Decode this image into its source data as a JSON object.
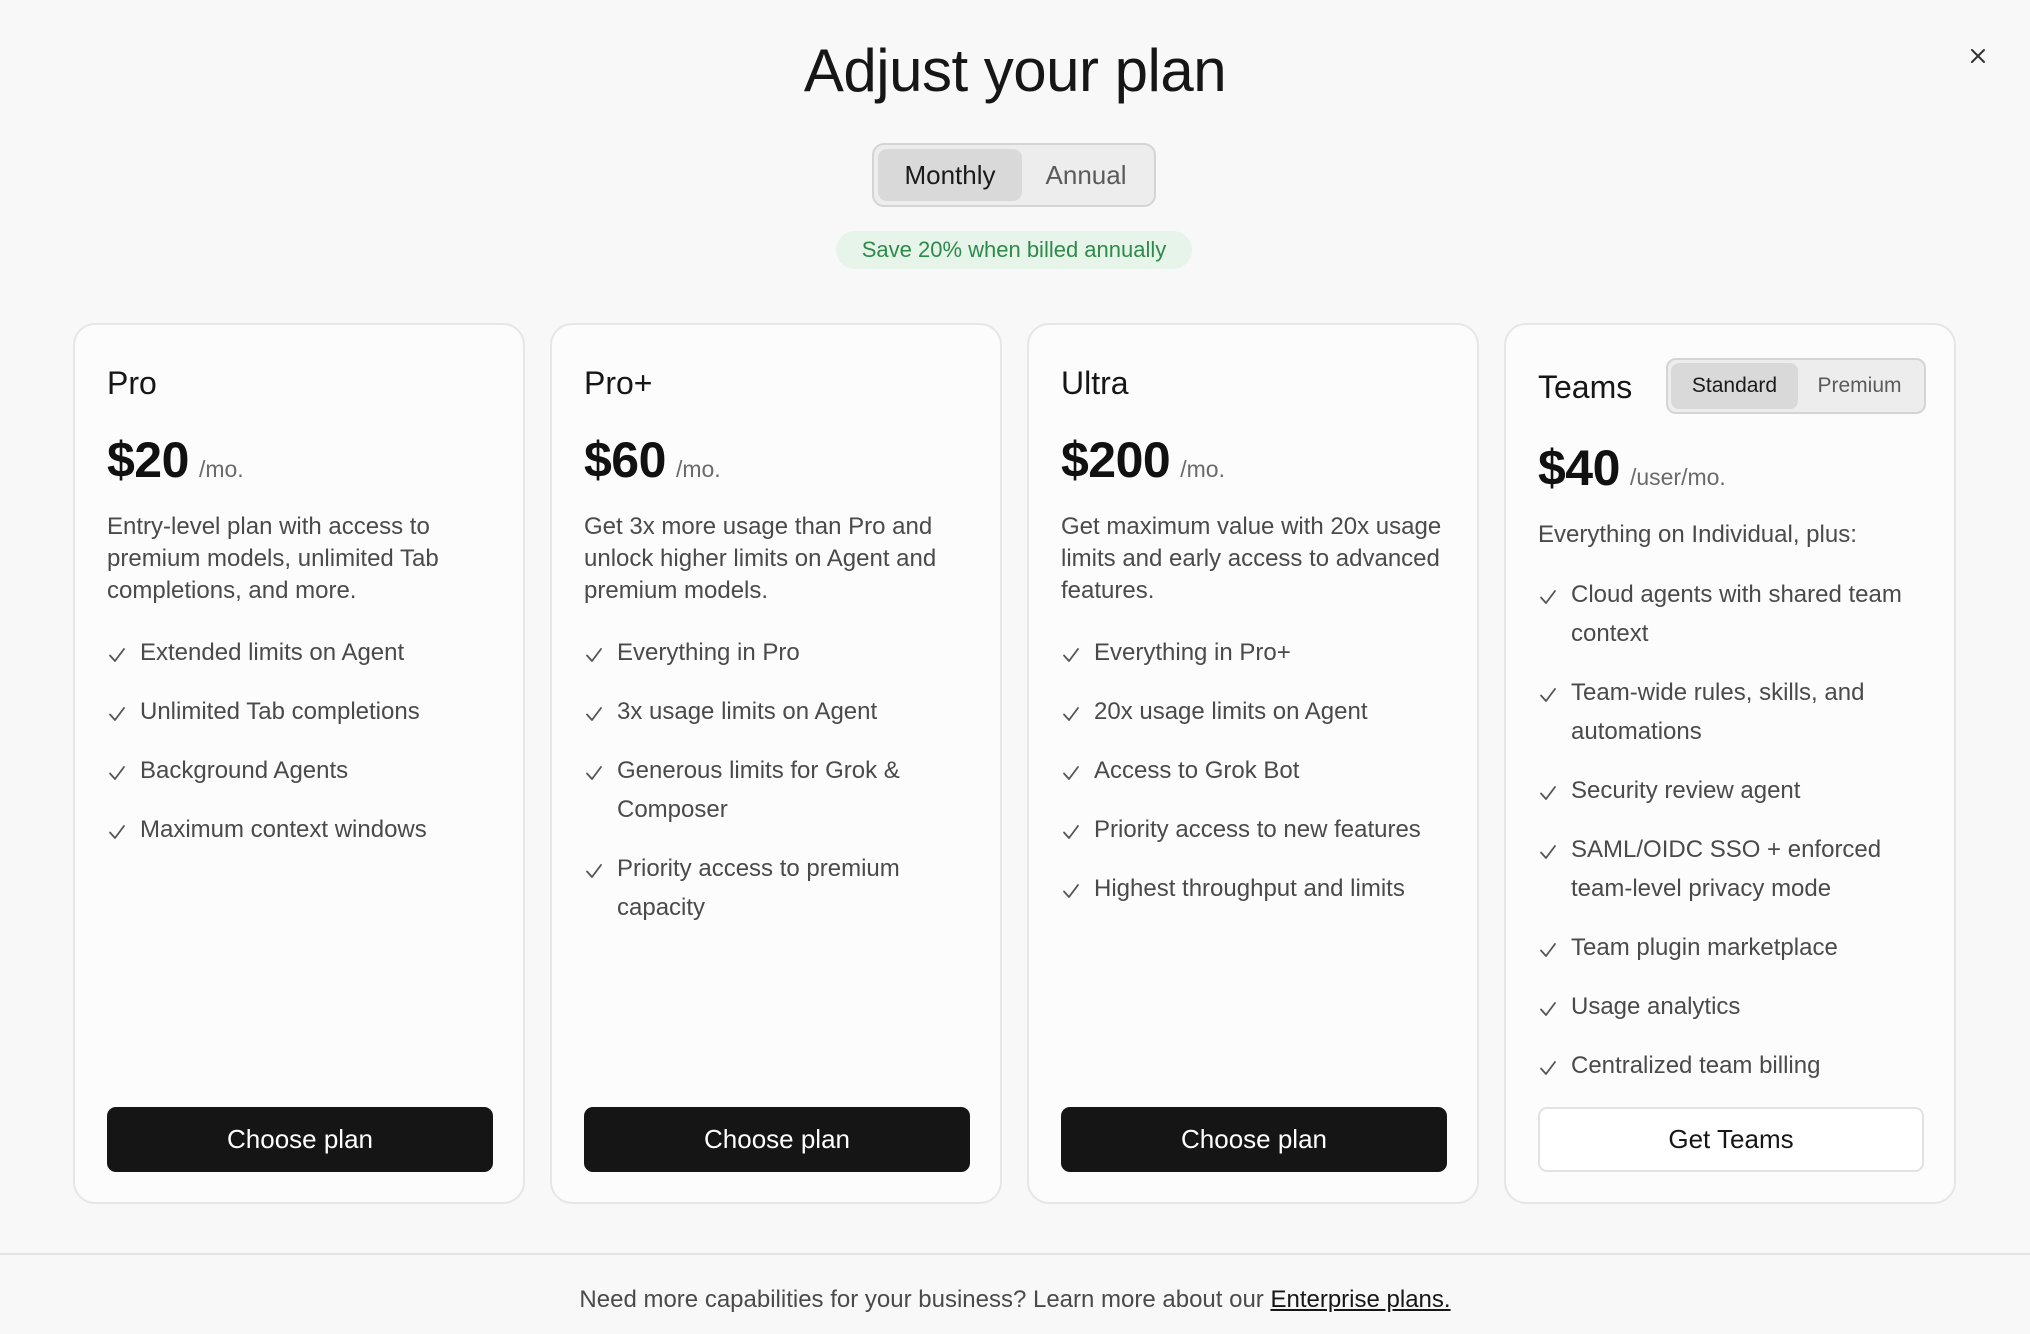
{
  "dialog": {
    "title": "Adjust your plan",
    "close_icon": "close-icon"
  },
  "billing": {
    "options": [
      "Monthly",
      "Annual"
    ],
    "selected": "Monthly",
    "save_note": "Save 20% when billed annually",
    "save_note_color": "#2e8a4a"
  },
  "plans": [
    {
      "name": "Pro",
      "price": "$20",
      "period": "/mo.",
      "description": "Entry-level plan with access to premium models, unlimited Tab completions, and more.",
      "features": [
        "Extended limits on Agent",
        "Unlimited Tab completions",
        "Background Agents",
        "Maximum context windows"
      ],
      "cta": "Choose plan"
    },
    {
      "name": "Pro+",
      "price": "$60",
      "period": "/mo.",
      "description": "Get 3x more usage than Pro and unlock higher limits on Agent and premium models.",
      "features": [
        "Everything in Pro",
        "3x usage limits on Agent",
        "Generous limits for Grok & Composer",
        "Priority access to premium capacity"
      ],
      "cta": "Choose plan"
    },
    {
      "name": "Ultra",
      "price": "$200",
      "period": "/mo.",
      "description": "Get maximum value with 20x usage limits and early access to advanced features.",
      "features": [
        "Everything in Pro+",
        "20x usage limits on Agent",
        "Access to Grok Bot",
        "Priority access to new features",
        "Highest throughput and limits"
      ],
      "cta": "Choose plan"
    },
    {
      "name": "Teams",
      "tier_options": [
        "Standard",
        "Premium"
      ],
      "tier_selected": "Standard",
      "price": "$40",
      "period": "/user/mo.",
      "description": "Everything on Individual, plus:",
      "features": [
        "Cloud agents with shared team context",
        "Team-wide rules, skills, and automations",
        "Security review agent",
        "SAML/OIDC SSO + enforced team-level privacy mode",
        "Team plugin marketplace",
        "Usage analytics",
        "Centralized team billing"
      ],
      "cta": "Get Teams"
    }
  ],
  "footer": {
    "text": "Need more capabilities for your business? Learn more about our ",
    "link_label": "Enterprise plans."
  },
  "icons": {
    "feature": "check-icon",
    "close": "close-icon"
  },
  "colors": {
    "primary_button": "#151515",
    "save_badge_bg": "#e6f4e9"
  }
}
